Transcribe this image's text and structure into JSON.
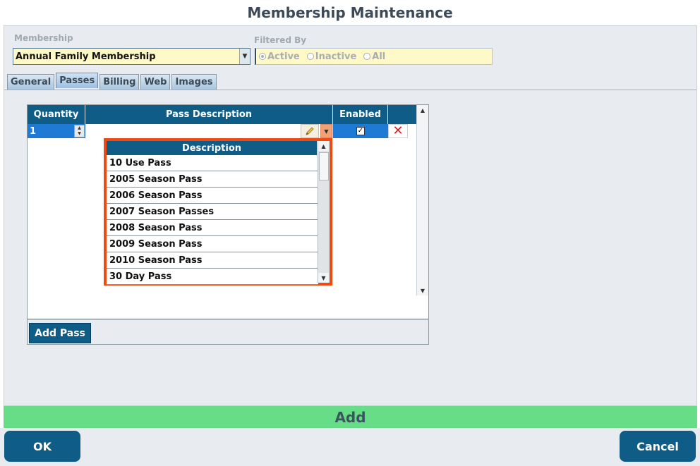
{
  "window": {
    "title": "Membership Maintenance"
  },
  "membership": {
    "label": "Membership",
    "value": "Annual Family Membership"
  },
  "filter": {
    "label": "Filtered By",
    "options": [
      "Active",
      "Inactive",
      "All"
    ],
    "selected": "Active"
  },
  "tabs": [
    {
      "label": "General"
    },
    {
      "label": "Passes"
    },
    {
      "label": "Billing"
    },
    {
      "label": "Web"
    },
    {
      "label": "Images"
    }
  ],
  "active_tab": "Passes",
  "grid": {
    "columns": [
      "Quantity",
      "Pass Description",
      "Enabled"
    ],
    "rows": [
      {
        "quantity": "1",
        "description": "",
        "enabled": true
      }
    ],
    "add_pass_label": "Add Pass"
  },
  "dropdown": {
    "header": "Description",
    "items": [
      "10 Use Pass",
      "2005 Season Pass",
      "2006 Season Pass",
      "2007 Season Passes",
      "2008 Season Pass",
      "2009 Season Pass",
      "2010 Season Pass",
      "30 Day Pass"
    ]
  },
  "add_bar": {
    "label": "Add"
  },
  "buttons": {
    "ok": "OK",
    "cancel": "Cancel"
  },
  "colors": {
    "accent": "#0f5c87",
    "highlight": "#ee4a12",
    "add_bar": "#66dd86",
    "input_bg": "#fff9c8"
  },
  "icons": {
    "edit": "pencil-icon",
    "dropdown": "chevron-down-icon",
    "delete": "close-icon",
    "check": "checkmark-icon"
  }
}
